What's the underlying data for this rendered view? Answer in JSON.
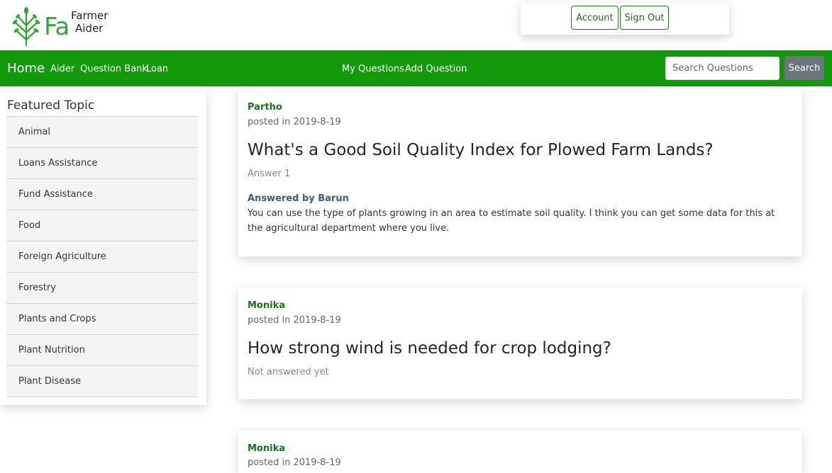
{
  "brand": {
    "short": "Fa",
    "name_line1": "Farmer",
    "name_line2": "Aider"
  },
  "account": {
    "account_label": "Account",
    "signout_label": "Sign Out"
  },
  "nav": {
    "home": "Home",
    "left_links": [
      "Aider",
      "Question Bank",
      "Loan"
    ],
    "center_links": [
      "My Questions",
      "Add Question"
    ],
    "search_placeholder": "Search Questions",
    "search_button": "Search"
  },
  "sidebar": {
    "title": "Featured Topic",
    "topics": [
      "Animal",
      "Loans Assistance",
      "Fund Assistance",
      "Food",
      "Foreign Agriculture",
      "Forestry",
      "Plants and Crops",
      "Plant Nutrition",
      "Plant Disease"
    ]
  },
  "questions": [
    {
      "author": "Partho",
      "posted": "posted in 2019-8-19",
      "title": "What's a Good Soil Quality Index for Plowed Farm Lands?",
      "status": "Answer 1",
      "answered_by": "Answered by Barun",
      "answer": "You can use the type of plants growing in an area to estimate soil quality. I think you can get some data for this at the agricultural department where you live."
    },
    {
      "author": "Monika",
      "posted": "posted in 2019-8-19",
      "title": "How strong wind is needed for crop lodging?",
      "status": "Not answered yet"
    },
    {
      "author": "Monika",
      "posted": "posted in 2019-8-19"
    }
  ],
  "colors": {
    "nav_green": "#129a0b",
    "brand_green": "#3aa23a",
    "author_green": "#1d6e1d",
    "answered_blue": "#3d5a80",
    "search_gray": "#6c757d"
  }
}
